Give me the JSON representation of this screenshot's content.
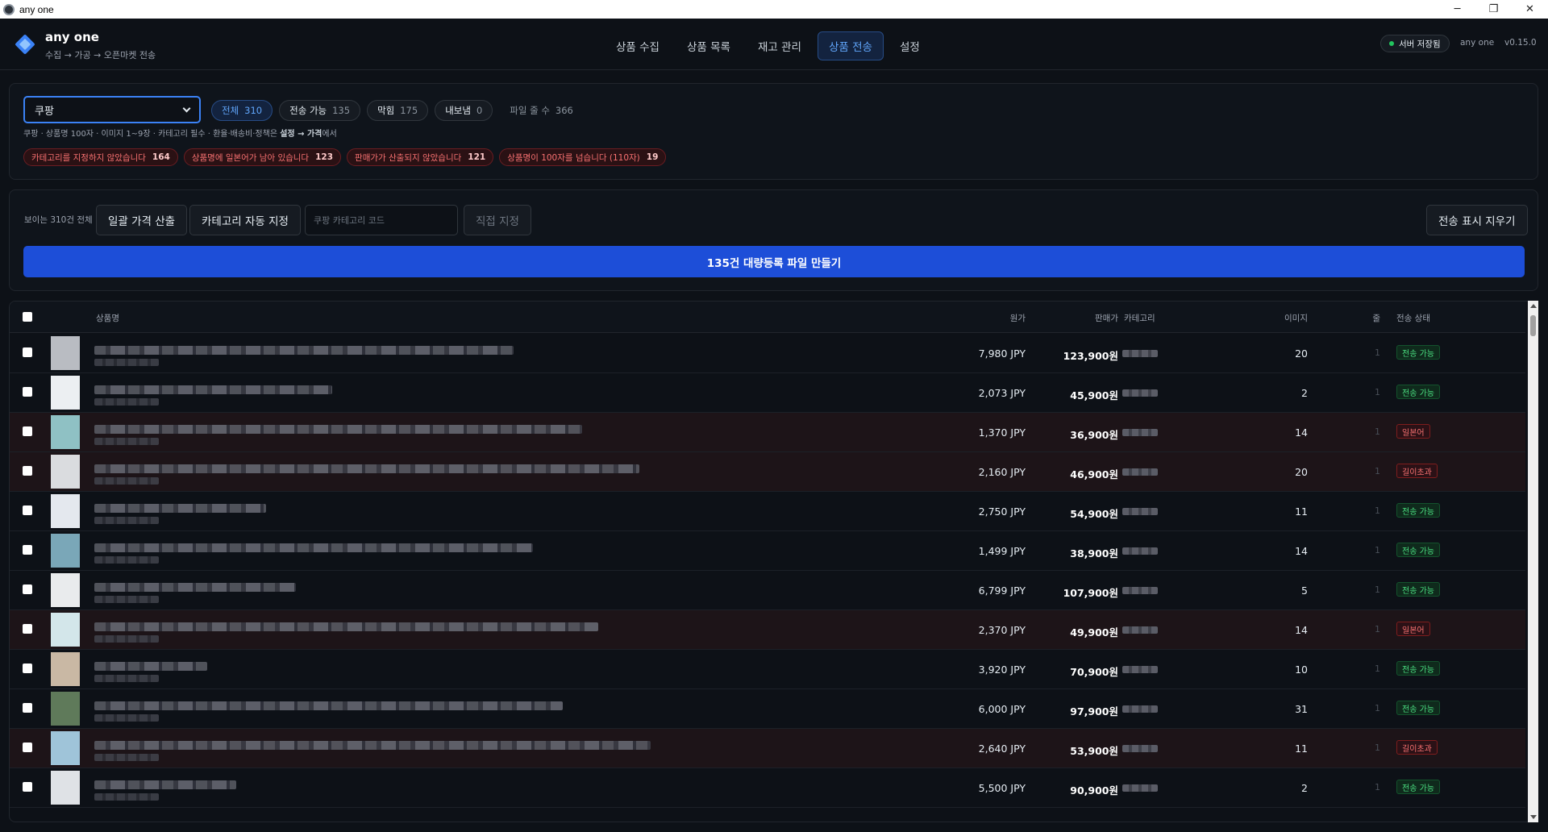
{
  "window": {
    "title": "any one",
    "controls": [
      "─",
      "❐",
      "✕"
    ]
  },
  "header": {
    "brand_name": "any one",
    "brand_sub": "수집 → 가공 → 오픈마켓 전송",
    "tabs": [
      {
        "label": "상품 수집"
      },
      {
        "label": "상품 목록"
      },
      {
        "label": "재고 관리"
      },
      {
        "label": "상품 전송",
        "active": true
      },
      {
        "label": "설정"
      }
    ],
    "server_status": "서버 저장됨",
    "user": "any one",
    "version": "v0.15.0"
  },
  "filters": {
    "market": "쿠팡",
    "pills": [
      {
        "label": "전체",
        "count": "310",
        "active": true
      },
      {
        "label": "전송 가능",
        "count": "135"
      },
      {
        "label": "막힘",
        "count": "175"
      },
      {
        "label": "내보냄",
        "count": "0"
      },
      {
        "label": "파일 줄 수",
        "count": "366",
        "dim": true
      }
    ],
    "hint_prefix": "쿠팡 · 상품명 100자 · 이미지 1~9장 · 카테고리 필수 · 환율·배송비·정책은",
    "hint_bold": "설정 → 가격",
    "hint_suffix": "에서",
    "errors": [
      {
        "label": "카테고리를 지정하지 않았습니다",
        "count": "164"
      },
      {
        "label": "상품명에 일본어가 남아 있습니다",
        "count": "123"
      },
      {
        "label": "판매가가 산출되지 않았습니다",
        "count": "121"
      },
      {
        "label": "상품명이 100자를 넘습니다 (110자)",
        "count": "19"
      }
    ]
  },
  "actions": {
    "visible_label": "보이는 310건 전체",
    "bulk_price": "일괄 가격 산출",
    "auto_category": "카테고리 자동 지정",
    "category_placeholder": "쿠팡 카테고리 코드",
    "manual_assign": "직접 지정",
    "clear_marks": "전송 표시 지우기",
    "create_file": "135건 대량등록 파일 만들기"
  },
  "table": {
    "headers": {
      "name": "상품명",
      "cost": "원가",
      "price": "판매가",
      "category": "카테고리",
      "images": "이미지",
      "qty": "줄",
      "status": "전송 상태"
    },
    "rows": [
      {
        "cost": "7,980 JPY",
        "price": "123,900원",
        "images": "20",
        "qty": "1",
        "status": "전송 가능",
        "ok": true
      },
      {
        "cost": "2,073 JPY",
        "price": "45,900원",
        "images": "2",
        "qty": "1",
        "status": "전송 가능",
        "ok": true
      },
      {
        "cost": "1,370 JPY",
        "price": "36,900원",
        "images": "14",
        "qty": "1",
        "status": "일본어",
        "ok": false
      },
      {
        "cost": "2,160 JPY",
        "price": "46,900원",
        "images": "20",
        "qty": "1",
        "status": "길이초과",
        "ok": false
      },
      {
        "cost": "2,750 JPY",
        "price": "54,900원",
        "images": "11",
        "qty": "1",
        "status": "전송 가능",
        "ok": true
      },
      {
        "cost": "1,499 JPY",
        "price": "38,900원",
        "images": "14",
        "qty": "1",
        "status": "전송 가능",
        "ok": true
      },
      {
        "cost": "6,799 JPY",
        "price": "107,900원",
        "images": "5",
        "qty": "1",
        "status": "전송 가능",
        "ok": true
      },
      {
        "cost": "2,370 JPY",
        "price": "49,900원",
        "images": "14",
        "qty": "1",
        "status": "일본어",
        "ok": false
      },
      {
        "cost": "3,920 JPY",
        "price": "70,900원",
        "images": "10",
        "qty": "1",
        "status": "전송 가능",
        "ok": true
      },
      {
        "cost": "6,000 JPY",
        "price": "97,900원",
        "images": "31",
        "qty": "1",
        "status": "전송 가능",
        "ok": true
      },
      {
        "cost": "2,640 JPY",
        "price": "53,900원",
        "images": "11",
        "qty": "1",
        "status": "길이초과",
        "ok": false
      },
      {
        "cost": "5,500 JPY",
        "price": "90,900원",
        "images": "2",
        "qty": "1",
        "status": "전송 가능",
        "ok": true
      }
    ]
  },
  "colors": {
    "accent": "#3b82f6",
    "primary_button": "#1d4ed8",
    "ok": "#4ade80",
    "error": "#f87171"
  }
}
